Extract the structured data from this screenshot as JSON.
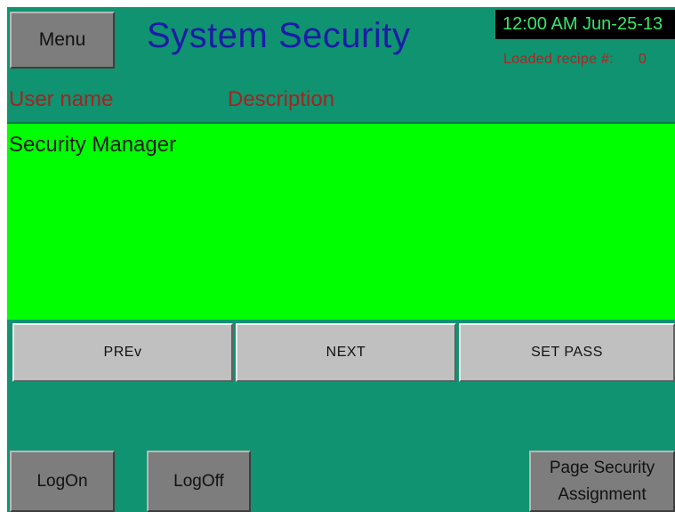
{
  "header": {
    "menu_label": "Menu",
    "title": "System Security",
    "datetime": "12:00 AM Jun-25-13",
    "recipe_label": "Loaded recipe #:",
    "recipe_value": "0"
  },
  "columns": {
    "user": "User name",
    "description": "Description"
  },
  "users": [
    {
      "name": "Security Manager",
      "description": ""
    }
  ],
  "nav": {
    "prev": "PREv",
    "next": "NEXT",
    "set_pass": "SET PASS"
  },
  "footer": {
    "logon": "LogOn",
    "logoff": "LogOff",
    "page_security_line1": "Page Security",
    "page_security_line2": "Assignment"
  },
  "colors": {
    "background": "#0f9370",
    "list_background": "#00ff00",
    "title": "#1c1ca8",
    "header_text": "#a52323",
    "clock_text": "#34e86a"
  }
}
